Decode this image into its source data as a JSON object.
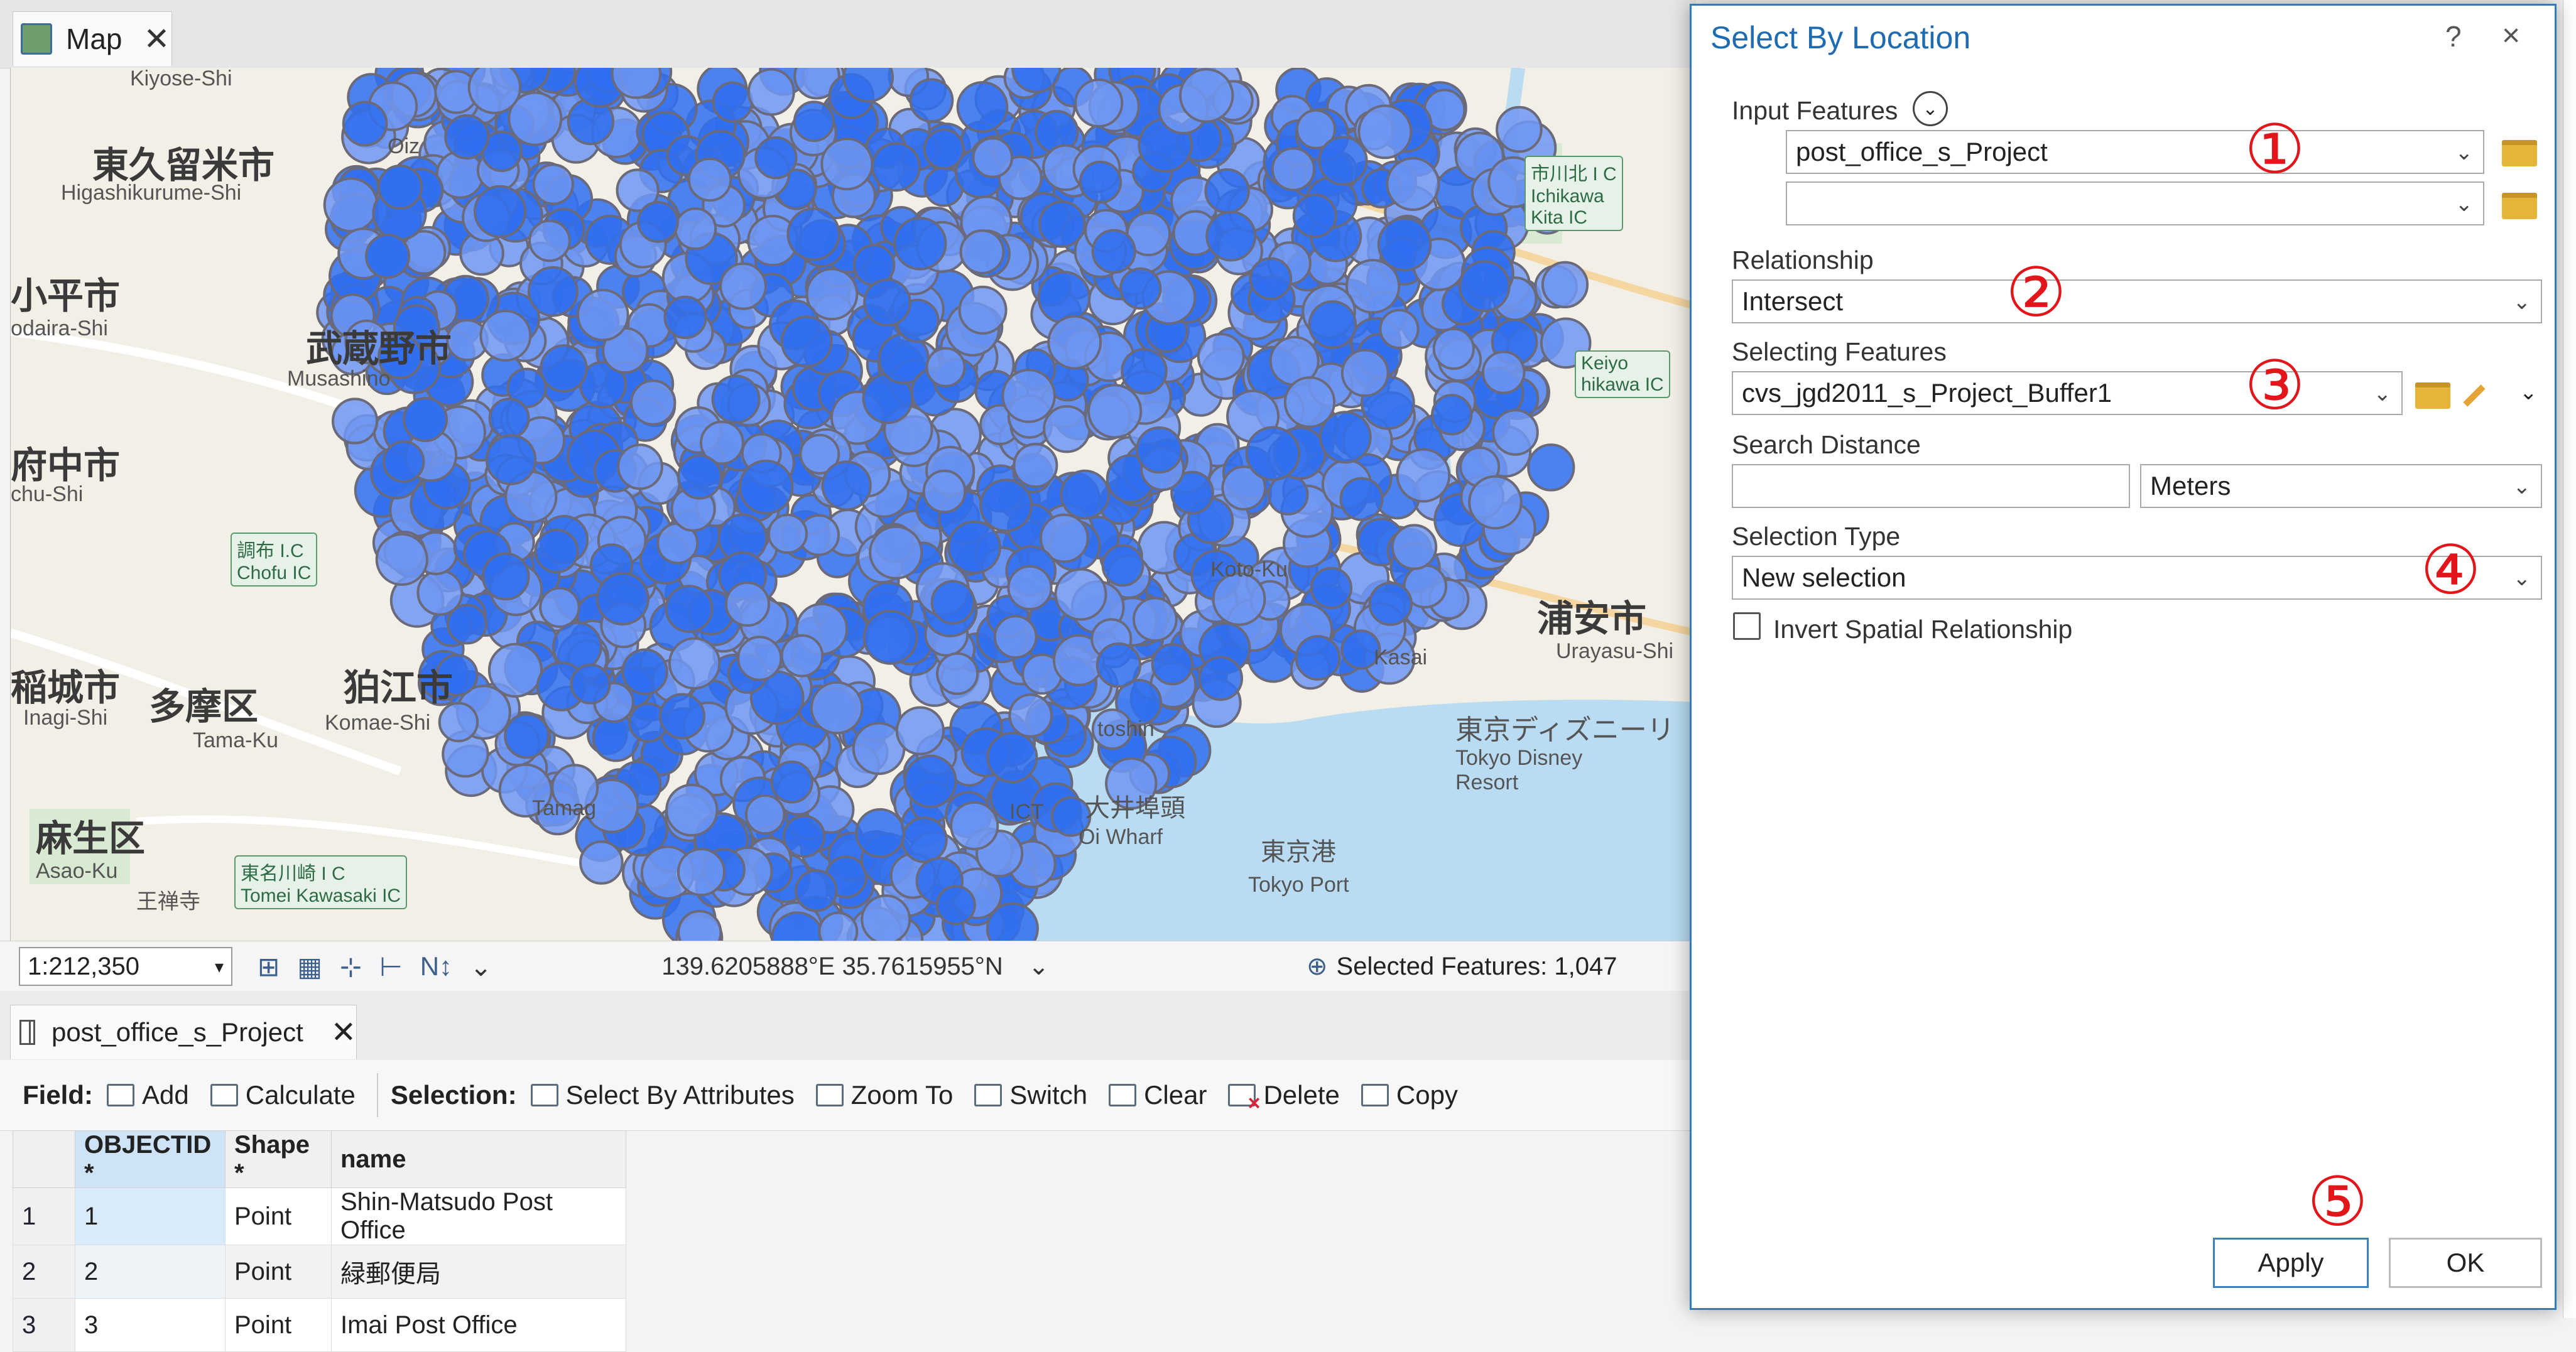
{
  "map_tab": {
    "label": "Map"
  },
  "map": {
    "labels": {
      "kiyose": "Kiyose-Shi",
      "higashikurume_jp": "東久留米市",
      "higashikurume": "Higashikurume-Shi",
      "kodaira_jp": "小平市",
      "kodaira": "odaira-Shi",
      "musashino_jp": "武蔵野市",
      "musashino": "Musashino",
      "fuchu_jp": "府中市",
      "fuchu": "chu-Shi",
      "chofu_ic": "調布 I.C\nChofu IC",
      "inagi_jp": "稲城市",
      "inagi": "Inagi-Shi",
      "tama_jp": "多摩区",
      "tama": "Tama-Ku",
      "komae_jp": "狛江市",
      "komae": "Komae-Shi",
      "asao_jp": "麻生区",
      "asao": "Asao-Ku",
      "oiz": "Oiz",
      "ichikawa_ic": "市川北 I C\nIchikawa\nKita IC",
      "keiyo": "Keiyo\nhikawa IC",
      "koto": "Koto-Ku",
      "urayasu_jp": "浦安市",
      "urayasu": "Urayasu-Shi",
      "disney_jp": "東京ディズニーリ",
      "disney": "Tokyo Disney\nResort",
      "kasai": "Kasai",
      "oi_wharf_jp": "大井埠頭",
      "oi_wharf": "Oi Wharf",
      "tokyo_port_jp": "東京港",
      "tokyo_port": "Tokyo Port",
      "tamagawa_ic": "東名川崎 I C\nTomei Kawasaki IC",
      "oji": "王禅寺",
      "tama2": "Tamag",
      "toshin": "toshin",
      "ict": "ICT"
    }
  },
  "statusbar": {
    "scale": "1:212,350",
    "coordinates": "139.6205888°E 35.7615955°N",
    "selected_features": "Selected Features: 1,047"
  },
  "table": {
    "tab_label": "post_office_s_Project",
    "toolbar": {
      "field_label": "Field:",
      "add": "Add",
      "calculate": "Calculate",
      "selection_label": "Selection:",
      "select_by_attributes": "Select By Attributes",
      "zoom_to": "Zoom To",
      "switch": "Switch",
      "clear": "Clear",
      "delete": "Delete",
      "copy": "Copy"
    },
    "columns": [
      "OBJECTID *",
      "Shape *",
      "name"
    ],
    "rows": [
      {
        "row": "1",
        "oid": "1",
        "shape": "Point",
        "name": "Shin-Matsudo Post Office"
      },
      {
        "row": "2",
        "oid": "2",
        "shape": "Point",
        "name": "緑郵便局"
      },
      {
        "row": "3",
        "oid": "3",
        "shape": "Point",
        "name": "Imai Post Office"
      }
    ]
  },
  "dialog": {
    "title": "Select By Location",
    "help": "?",
    "close": "×",
    "input_features_label": "Input Features",
    "input_features_value": "post_office_s_Project",
    "input_features_value2": "",
    "relationship_label": "Relationship",
    "relationship_value": "Intersect",
    "selecting_features_label": "Selecting Features",
    "selecting_features_value": "cvs_jgd2011_s_Project_Buffer1",
    "search_distance_label": "Search Distance",
    "search_distance_value": "",
    "search_distance_unit": "Meters",
    "selection_type_label": "Selection Type",
    "selection_type_value": "New selection",
    "invert_label": "Invert Spatial Relationship",
    "apply": "Apply",
    "ok": "OK",
    "markers": [
      "①",
      "②",
      "③",
      "④",
      "⑤"
    ]
  },
  "colors": {
    "accent": "#1f6bb1",
    "point_fill": "#2f6ff0",
    "point_halo": "#6f96f2",
    "water": "#b9dcf2",
    "marker_red": "#e2151b"
  },
  "icons": [
    "map-icon",
    "close-icon",
    "table-icon",
    "add-field-icon",
    "calculate-icon",
    "select-by-attributes-icon",
    "zoom-to-icon",
    "switch-icon",
    "clear-icon",
    "delete-icon",
    "copy-icon",
    "folder-icon",
    "pencil-icon",
    "chevron-down-icon",
    "expand-icon",
    "help-icon"
  ]
}
